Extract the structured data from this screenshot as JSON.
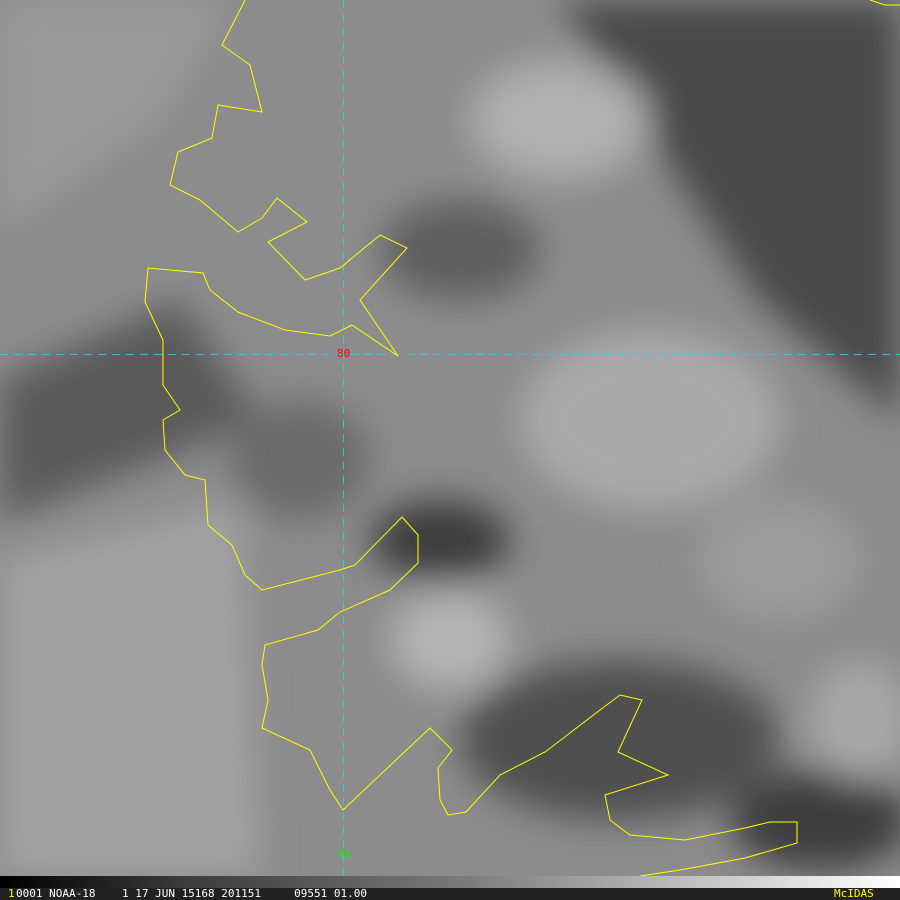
{
  "image": {
    "satellite": "NOAA-18",
    "grid_labels": {
      "latitude": "80",
      "longitude": "95"
    },
    "colors": {
      "coastline": "#ffff00",
      "grid": "#2ad6d6",
      "lat_label": "#ff0000",
      "lon_label": "#00ff00"
    }
  },
  "infobar": {
    "frame_number": "1",
    "info_text": "0001 NOAA-18    1 17 JUN 15168 201151     09551 01.00",
    "brand": "McIDAS"
  }
}
